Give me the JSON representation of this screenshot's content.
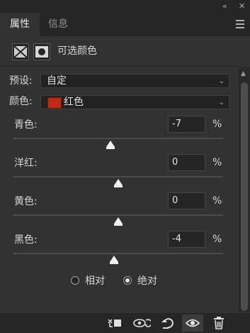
{
  "tabs": [
    {
      "label": "属性"
    },
    {
      "label": "信息"
    }
  ],
  "header": {
    "title": "可选颜色"
  },
  "preset": {
    "label": "预设:",
    "value": "自定"
  },
  "colors": {
    "label": "颜色:",
    "value": "红色",
    "swatch": "#c12a12"
  },
  "sliders": [
    {
      "label": "青色:",
      "value": "-7",
      "unit": "%",
      "level": -0.07
    },
    {
      "label": "洋红:",
      "value": "0",
      "unit": "%",
      "level": 0
    },
    {
      "label": "黄色:",
      "value": "0",
      "unit": "%",
      "level": 0
    },
    {
      "label": "黑色:",
      "value": "-4",
      "unit": "%",
      "level": -0.04
    }
  ],
  "method": {
    "relative": "相对",
    "absolute": "绝对",
    "selected": "absolute"
  },
  "footer_icons": [
    "clip-to-layer-icon",
    "view-previous-state-icon",
    "reset-icon",
    "visibility-eye-icon",
    "trash-icon"
  ]
}
